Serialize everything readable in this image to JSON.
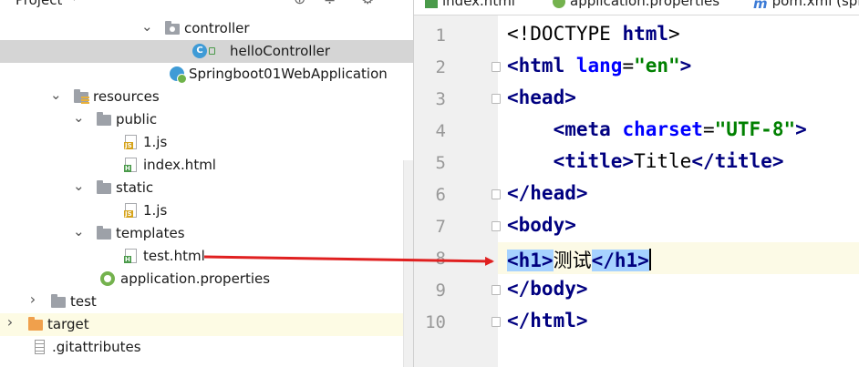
{
  "project_panel": {
    "title": "Project",
    "tree": [
      {
        "label": "controller",
        "type": "package",
        "chevron": "expanded",
        "indent": 160
      },
      {
        "label": "helloController",
        "type": "class",
        "selected": true,
        "indent": 210
      },
      {
        "label": "Springboot01WebApplication",
        "type": "boot-class",
        "indent": 185
      },
      {
        "label": "resources",
        "type": "resources-folder",
        "chevron": "expanded",
        "indent": 60
      },
      {
        "label": "public",
        "type": "folder",
        "chevron": "expanded",
        "indent": 85
      },
      {
        "label": "1.js",
        "type": "js-file",
        "indent": 135
      },
      {
        "label": "index.html",
        "type": "html-file",
        "indent": 135
      },
      {
        "label": "static",
        "type": "folder",
        "chevron": "expanded",
        "indent": 85
      },
      {
        "label": "1.js",
        "type": "js-file",
        "indent": 135
      },
      {
        "label": "templates",
        "type": "folder",
        "chevron": "expanded",
        "indent": 85
      },
      {
        "label": "test.html",
        "type": "html-file",
        "indent": 135
      },
      {
        "label": "application.properties",
        "type": "properties-file",
        "indent": 110
      },
      {
        "label": "test",
        "type": "folder",
        "chevron": "collapsed",
        "indent": 35
      },
      {
        "label": "target",
        "type": "target-folder",
        "chevron": "collapsed",
        "highlight": true,
        "indent": 10
      },
      {
        "label": ".gitattributes",
        "type": "text-file",
        "indent": 35
      }
    ]
  },
  "editor": {
    "tabs": [
      {
        "label": "index.html",
        "icon": "html-file-icon"
      },
      {
        "label": "application.properties",
        "icon": "properties-file-icon"
      },
      {
        "label": "pom.xml (spi",
        "icon": "maven-icon"
      }
    ],
    "line_numbers": [
      "1",
      "2",
      "3",
      "4",
      "5",
      "6",
      "7",
      "8",
      "9",
      "10"
    ],
    "lines": [
      {
        "indent": "",
        "parts": [
          {
            "t": "<!DOCTYPE ",
            "c": "doc"
          },
          {
            "t": "html",
            "c": "tag"
          },
          {
            "t": ">",
            "c": "doc"
          }
        ]
      },
      {
        "indent": "",
        "parts": [
          {
            "t": "<html ",
            "c": "tag"
          },
          {
            "t": "lang",
            "c": "attr"
          },
          {
            "t": "=",
            "c": "text"
          },
          {
            "t": "\"en\"",
            "c": "val"
          },
          {
            "t": ">",
            "c": "tag"
          }
        ]
      },
      {
        "indent": "",
        "parts": [
          {
            "t": "<head>",
            "c": "tag"
          }
        ]
      },
      {
        "indent": "    ",
        "parts": [
          {
            "t": "<meta ",
            "c": "tag"
          },
          {
            "t": "charset",
            "c": "attr"
          },
          {
            "t": "=",
            "c": "text"
          },
          {
            "t": "\"UTF-8\"",
            "c": "val"
          },
          {
            "t": ">",
            "c": "tag"
          }
        ]
      },
      {
        "indent": "    ",
        "parts": [
          {
            "t": "<title>",
            "c": "tag"
          },
          {
            "t": "Title",
            "c": "text"
          },
          {
            "t": "</title>",
            "c": "tag"
          }
        ]
      },
      {
        "indent": "",
        "parts": [
          {
            "t": "</head>",
            "c": "tag"
          }
        ]
      },
      {
        "indent": "",
        "parts": [
          {
            "t": "<body>",
            "c": "tag"
          }
        ]
      },
      {
        "indent": "",
        "parts": [
          {
            "t": "<h1>",
            "c": "tag",
            "hl": true
          },
          {
            "t": "测试",
            "c": "text"
          },
          {
            "t": "</h1>",
            "c": "tag",
            "hl": true
          }
        ],
        "current": true
      },
      {
        "indent": "",
        "parts": [
          {
            "t": "</body>",
            "c": "tag"
          }
        ]
      },
      {
        "indent": "",
        "parts": [
          {
            "t": "</html>",
            "c": "tag"
          }
        ]
      }
    ]
  },
  "colors": {
    "arrow": "#e02020",
    "selection": "#d5d5d5",
    "bracket_highlight": "#a6d2ff"
  }
}
